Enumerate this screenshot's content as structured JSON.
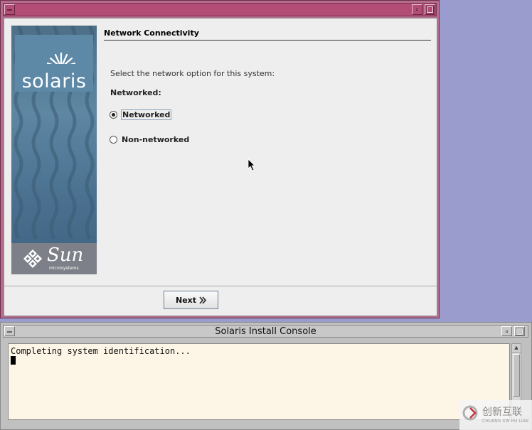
{
  "installer": {
    "page_title": "Network Connectivity",
    "prompt": "Select the network option for this system:",
    "group_label": "Networked:",
    "options": [
      {
        "label": "Networked",
        "selected": true
      },
      {
        "label": "Non-networked",
        "selected": false
      }
    ],
    "next_label": "Next",
    "next_icon": "double-chevron-right-icon"
  },
  "banner": {
    "product_logo": "solaris",
    "vendor_logo": "Sun",
    "vendor_sub": "microsystems"
  },
  "console": {
    "title": "Solaris Install Console",
    "text": "Completing system identification..."
  },
  "watermark": {
    "text": "创新互联",
    "sub": "CHUANG XIN HU LIAN"
  },
  "colors": {
    "desktop": "#9a9ccd",
    "installer_frame": "#b24d76",
    "console_bg": "#fdf5e6"
  }
}
